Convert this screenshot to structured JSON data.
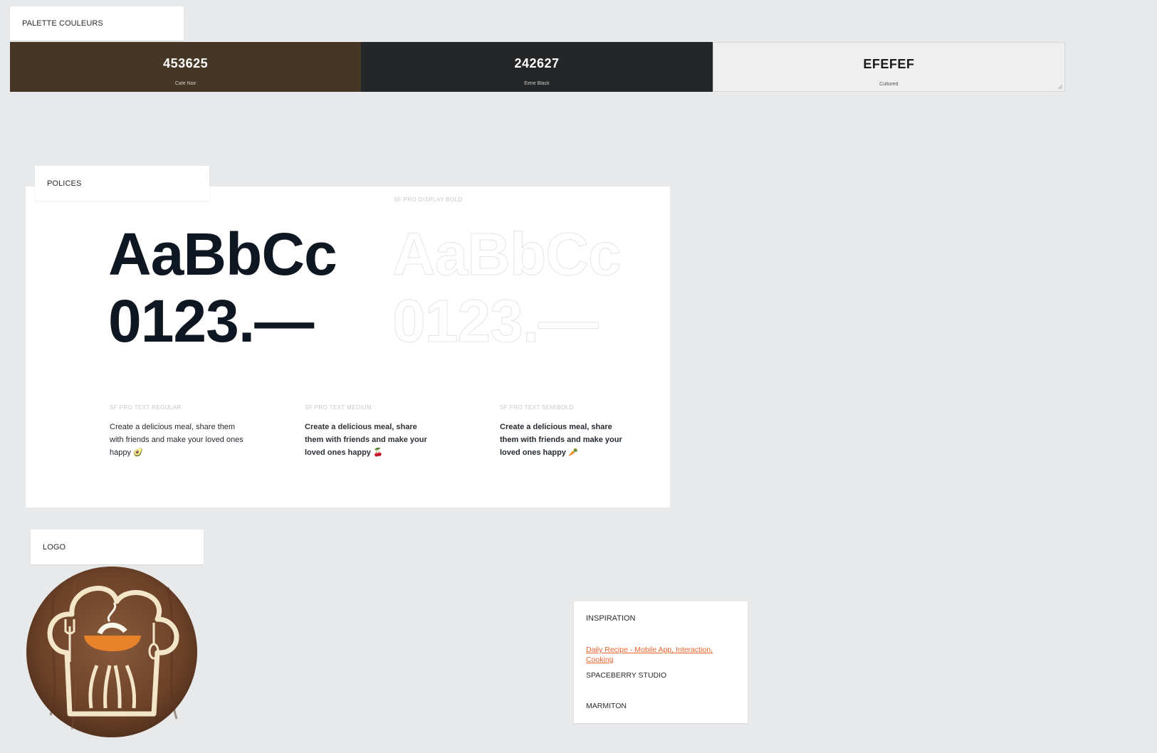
{
  "palette": {
    "label": "PALETTE COULEURS",
    "swatches": [
      {
        "hex": "453625",
        "name": "Cafe Noir",
        "color": "#453625",
        "text_color": "#ffffff"
      },
      {
        "hex": "242627",
        "name": "Eerie Black",
        "color": "#242627",
        "text_color": "#ffffff"
      },
      {
        "hex": "EFEFEF",
        "name": "Cultured",
        "color": "#efefef",
        "text_color": "#1a1a1a"
      }
    ]
  },
  "fonts": {
    "label": "POLICES",
    "display_bold_label": "SF PRO DISPLAY BOLD",
    "display_letters": "AaBbCc",
    "display_digits": "0123.—",
    "samples": [
      {
        "label": "SF PRO TEXT REGULAR",
        "text": "Create a delicious meal, share them with friends and make your loved ones happy 🥑"
      },
      {
        "label": "SF PRO TEXT MEDIUM",
        "text": "Create a delicious meal, share them with friends and make your loved ones happy 🍒"
      },
      {
        "label": "SF PRO TEXT SEMIBOLD",
        "text": "Create a delicious meal, share them with friends and make your loved ones happy 🥕"
      }
    ]
  },
  "logo": {
    "label": "LOGO"
  },
  "inspiration": {
    "title": "INSPIRATION",
    "link_text": "Daily Recipe - Mobile App, Interaction, Cooking",
    "studio": "SPACEBERRY STUDIO",
    "marmiton": "MARMITON"
  },
  "colors": {
    "background": "#e8e9eb",
    "link": "#e8622a"
  }
}
